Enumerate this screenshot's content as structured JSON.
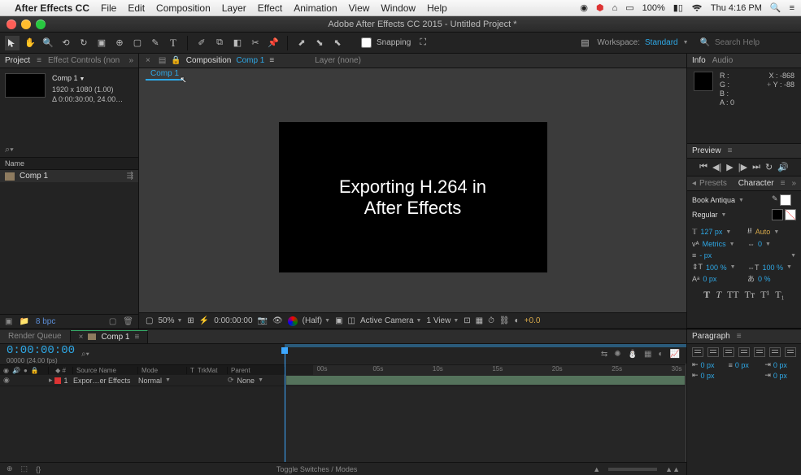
{
  "mac_menu": {
    "app_name": "After Effects CC",
    "items": [
      "File",
      "Edit",
      "Composition",
      "Layer",
      "Effect",
      "Animation",
      "View",
      "Window",
      "Help"
    ],
    "battery": "100%",
    "clock": "Thu 4:16 PM"
  },
  "window": {
    "title": "Adobe After Effects CC 2015 - Untitled Project *"
  },
  "toolbar": {
    "snapping_label": "Snapping",
    "workspace_label": "Workspace:",
    "workspace_value": "Standard",
    "search_placeholder": "Search Help"
  },
  "project": {
    "tab_project": "Project",
    "tab_effect_controls": "Effect Controls (non",
    "comp_name": "Comp 1",
    "dimensions": "1920 x 1080 (1.00)",
    "duration": "Δ 0:00:30:00, 24.00…",
    "col_name": "Name",
    "item_name": "Comp 1",
    "bpc": "8 bpc"
  },
  "viewer": {
    "tab_composition": "Composition",
    "tab_comp_name": "Comp 1",
    "layer_none": "Layer (none)",
    "mini_tab": "Comp 1",
    "canvas_line1": "Exporting H.264 in",
    "canvas_line2": "After Effects",
    "footer": {
      "zoom": "50%",
      "timecode": "0:00:00:00",
      "quality": "(Half)",
      "camera": "Active Camera",
      "views": "1 View",
      "exposure": "+0.0"
    }
  },
  "info": {
    "tab_info": "Info",
    "tab_audio": "Audio",
    "r": "R :",
    "g": "G :",
    "b": "B :",
    "a": "A : 0",
    "x": "X : -868",
    "y": "Y : -88"
  },
  "preview": {
    "tab": "Preview"
  },
  "character": {
    "tab_presets": "Presets",
    "tab_character": "Character",
    "font": "Book Antiqua",
    "style": "Regular",
    "size": "127 px",
    "leading": "Auto",
    "kerning": "Metrics",
    "tracking": "0",
    "stroke": "- px",
    "vscale": "100 %",
    "hscale": "100 %",
    "baseline": "0 px",
    "tsume": "0 %"
  },
  "timeline": {
    "tab_rq": "Render Queue",
    "tab_comp": "Comp 1",
    "timecode": "0:00:00:00",
    "timecode_sub": "00000 (24.00 fps)",
    "col_source": "Source Name",
    "col_mode": "Mode",
    "col_t": "T",
    "col_trkmat": "TrkMat",
    "col_parent": "Parent",
    "ruler": [
      "00s",
      "05s",
      "10s",
      "15s",
      "20s",
      "25s",
      "30s"
    ],
    "layer": {
      "index": "1",
      "name": "Expor…er Effects",
      "mode": "Normal",
      "parent": "None"
    },
    "toggle_switches": "Toggle Switches / Modes"
  },
  "paragraph": {
    "tab": "Paragraph",
    "indent_left": "0 px",
    "indent_first": "0 px",
    "indent_right": "0 px",
    "space_before": "0 px",
    "space_after": "0 px"
  }
}
